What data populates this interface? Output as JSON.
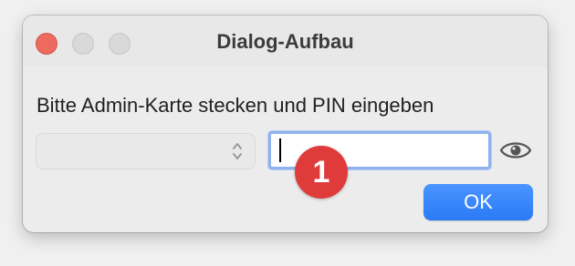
{
  "window": {
    "title": "Dialog-Aufbau"
  },
  "dialog": {
    "prompt": "Bitte Admin-Karte stecken und PIN eingeben",
    "card_select_value": "",
    "pin_value": "",
    "ok_label": "OK"
  },
  "annotation": {
    "badge_number": "1"
  },
  "icons": {
    "close": "close-icon",
    "minimize": "minimize-icon",
    "zoom": "zoom-icon",
    "select_chevron": "chevron-updown-icon",
    "reveal_pin": "eye-icon"
  },
  "colors": {
    "accent": "#2a7af5",
    "focus_ring": "#8fb2ec",
    "badge": "#e03b3b",
    "close_button": "#ed6a5e"
  }
}
